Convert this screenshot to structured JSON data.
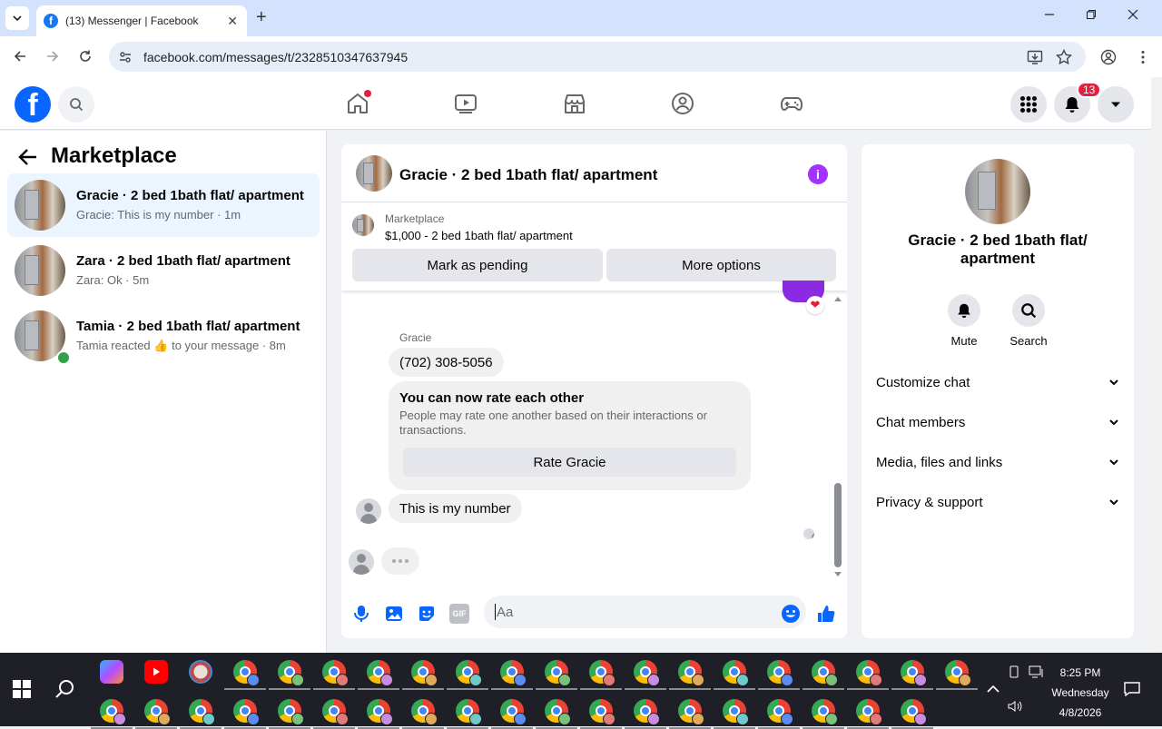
{
  "browser": {
    "tab_title": "(13) Messenger | Facebook",
    "url": "facebook.com/messages/t/2328510347637945",
    "new_tab": "+",
    "tab_close": "✕"
  },
  "header": {
    "notification_count": "13",
    "logo_letter": "f"
  },
  "sidebar": {
    "title": "Marketplace",
    "conversations": [
      {
        "title": "Gracie · 2 bed 1bath flat/ apartment",
        "subtitle": "Gracie: This is my number · 1m"
      },
      {
        "title": "Zara · 2 bed 1bath flat/ apartment",
        "subtitle": "Zara: Ok · 5m"
      },
      {
        "title": "Tamia · 2 bed 1bath flat/ apartment",
        "subtitle_pre": "Tamia reacted",
        "subtitle_emoji": "👍",
        "subtitle_post": "to your message · 8m"
      }
    ]
  },
  "chat": {
    "title": "Gracie · 2 bed 1bath flat/ apartment",
    "info_label": "i",
    "marketplace_label": "Marketplace",
    "listing": "$1,000 - 2 bed 1bath flat/ apartment",
    "mark_pending": "Mark as pending",
    "more_options": "More options",
    "sender_name": "Gracie",
    "phone_message": "(702) 308-5056",
    "rate_title": "You can now rate each other",
    "rate_desc": "People may rate one another based on their interactions or transactions.",
    "rate_button": "Rate Gracie",
    "last_message": "This is my number",
    "heart_reaction": "❤",
    "input_placeholder": "Aa",
    "gif_label": "GIF"
  },
  "details": {
    "name": "Gracie · 2 bed 1bath flat/ apartment",
    "mute": "Mute",
    "search": "Search",
    "rows": [
      "Customize chat",
      "Chat members",
      "Media, files and links",
      "Privacy & support"
    ]
  },
  "taskbar": {
    "time": "8:25 PM",
    "day": "Wednesday",
    "date": "4/8/2026"
  },
  "colors": {
    "facebook_blue": "#0866ff",
    "messenger_accent": "#a033ff",
    "badge_red": "#e41e3f",
    "active_row": "#ebf5ff"
  }
}
